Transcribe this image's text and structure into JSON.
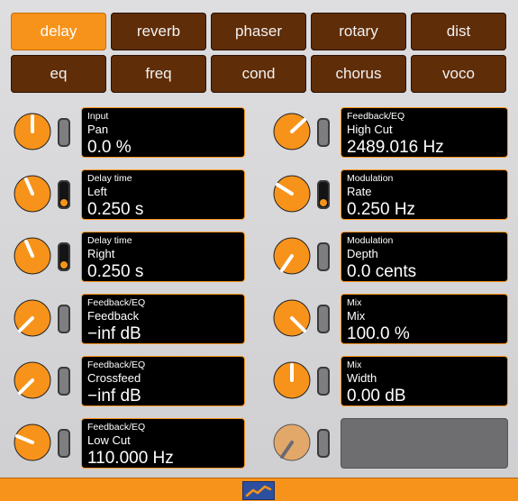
{
  "tabs": [
    {
      "label": "delay",
      "active": true
    },
    {
      "label": "reverb"
    },
    {
      "label": "phaser"
    },
    {
      "label": "rotary"
    },
    {
      "label": "dist"
    },
    {
      "label": "eq"
    },
    {
      "label": "freq"
    },
    {
      "label": "cond"
    },
    {
      "label": "chorus"
    },
    {
      "label": "voco"
    }
  ],
  "left": [
    {
      "category": "Input",
      "name": "Pan",
      "value": "0.0 %",
      "switch_on": false
    },
    {
      "category": "Delay time",
      "name": "Left",
      "value": "0.250 s",
      "switch_on": true
    },
    {
      "category": "Delay time",
      "name": "Right",
      "value": "0.250 s",
      "switch_on": true
    },
    {
      "category": "Feedback/EQ",
      "name": "Feedback",
      "value": "−inf dB",
      "switch_on": false
    },
    {
      "category": "Feedback/EQ",
      "name": "Crossfeed",
      "value": "−inf dB",
      "switch_on": false
    },
    {
      "category": "Feedback/EQ",
      "name": "Low Cut",
      "value": "110.000 Hz",
      "switch_on": false
    }
  ],
  "right": [
    {
      "category": "Feedback/EQ",
      "name": "High Cut",
      "value": "2489.016 Hz",
      "switch_on": false
    },
    {
      "category": "Modulation",
      "name": "Rate",
      "value": "0.250 Hz",
      "switch_on": true
    },
    {
      "category": "Modulation",
      "name": "Depth",
      "value": "0.0 cents",
      "switch_on": false
    },
    {
      "category": "Mix",
      "name": "Mix",
      "value": "100.0 %",
      "switch_on": false
    },
    {
      "category": "Mix",
      "name": "Width",
      "value": "0.00 dB",
      "switch_on": false
    },
    {
      "category": "",
      "name": "",
      "value": "",
      "switch_on": false,
      "disabled": true
    }
  ],
  "colors": {
    "accent": "#f7931a",
    "tab_bg": "#5f2d08",
    "panel_bg": "#000000"
  },
  "icons": {
    "footer_logo": "graph-logo-icon"
  }
}
